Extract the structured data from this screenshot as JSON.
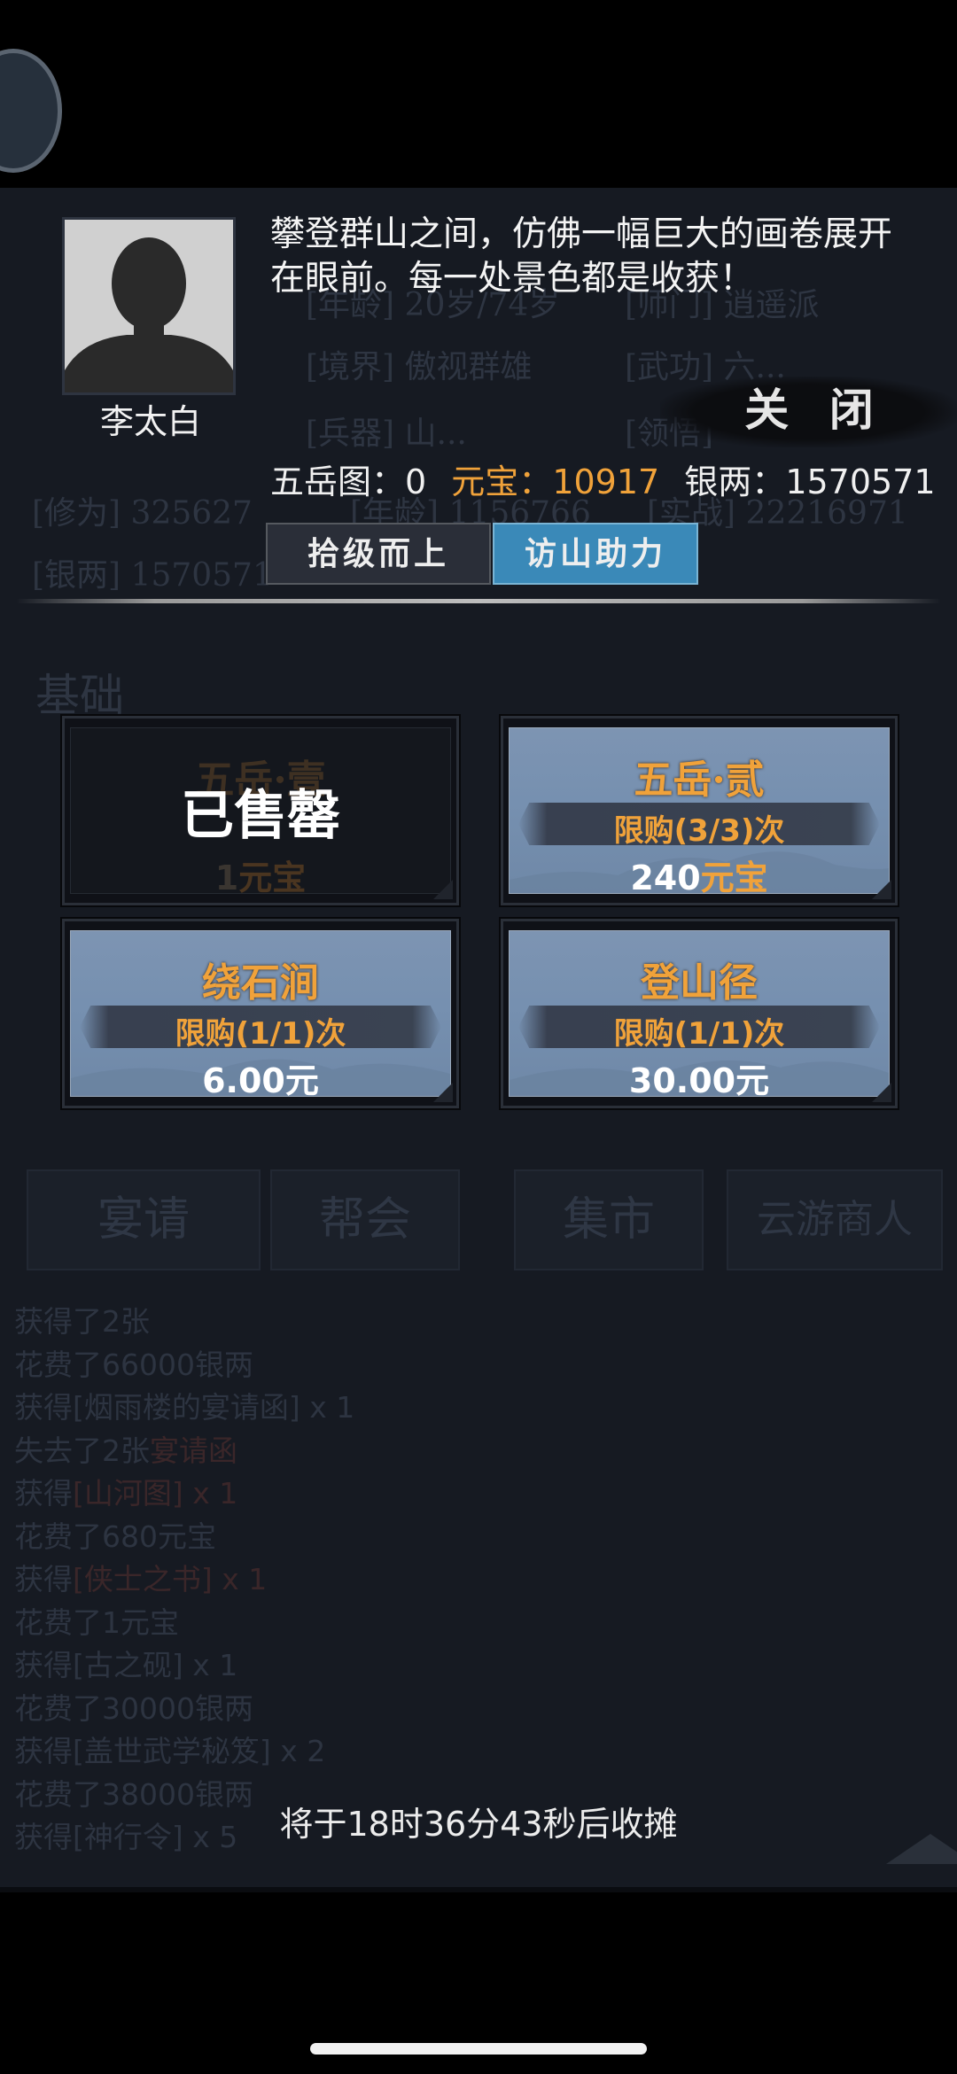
{
  "dialog": {
    "character_name": "李太白",
    "description": "攀登群山之间，仿佛一幅巨大的画卷展开在眼前。每一处景色都是收获！",
    "close_label": "关 闭",
    "stats": {
      "map_label": "五岳图：",
      "map_value": "0",
      "yuanbao_label": "元宝：",
      "yuanbao_value": "10917",
      "silver_label": "银两：",
      "silver_value": "1570571"
    },
    "buttons": {
      "ladder_label": "拾级而上",
      "assist_label": "访山助力"
    },
    "items": [
      {
        "title": "五岳·壹",
        "price_number": "1",
        "price_unit": "元宝",
        "sold_label": "已售罄",
        "sold_out": true
      },
      {
        "title": "五岳·贰",
        "limit": "限购(3/3)次",
        "price_number": "240",
        "price_unit": "元宝",
        "sold_out": false
      },
      {
        "title": "绕石涧",
        "limit": "限购(1/1)次",
        "price_number": "6.00",
        "price_unit": "元",
        "sold_out": false
      },
      {
        "title": "登山径",
        "limit": "限购(1/1)次",
        "price_number": "30.00",
        "price_unit": "元",
        "sold_out": false
      }
    ],
    "footer": "将于18时36分43秒后收摊"
  },
  "background": {
    "row1_a": "[年龄] 20岁/74岁",
    "row1_b": "[师门] 逍遥派",
    "row2_a": "[境界] 傲视群雄",
    "row2_b": "[武功] 六...",
    "row3_a": "[兵器] 山...",
    "row3_b": "[领悟]",
    "row4_a": "[修为] 325627",
    "row4_b": "[年龄] 1156766",
    "row4_c": "[实战] 22216971",
    "row5_a": "[银两] 1570571",
    "section_title": "基础",
    "tabs": [
      "宴请",
      "帮会",
      "集市",
      "云游商人"
    ],
    "log": [
      {
        "text": "获得了2张"
      },
      {
        "text": "花费了66000银两"
      },
      {
        "text": "获得[烟雨楼的宴请函] x 1"
      },
      {
        "text": "失去了2张",
        "hl": "宴请函"
      },
      {
        "text": "获得",
        "hl": "[山河图] x 1"
      },
      {
        "text": "花费了680元宝"
      },
      {
        "text": "获得",
        "hl": "[侠士之书] x 1"
      },
      {
        "text": "花费了1元宝"
      },
      {
        "text": "获得[古之砚] x 1"
      },
      {
        "text": "花费了30000银两"
      },
      {
        "text": "获得[盖世武学秘笈] x 2"
      },
      {
        "text": "花费了38000银两"
      },
      {
        "text": "获得[神行令] x 5"
      }
    ]
  },
  "colors": {
    "accent_gold": "#f0a23a",
    "assist_button": "#3a89b8",
    "panel": "#161a22"
  },
  "icons": {
    "avatar": "silhouette-avatar-icon",
    "scroll_up": "scroll-up-arrow-icon"
  }
}
